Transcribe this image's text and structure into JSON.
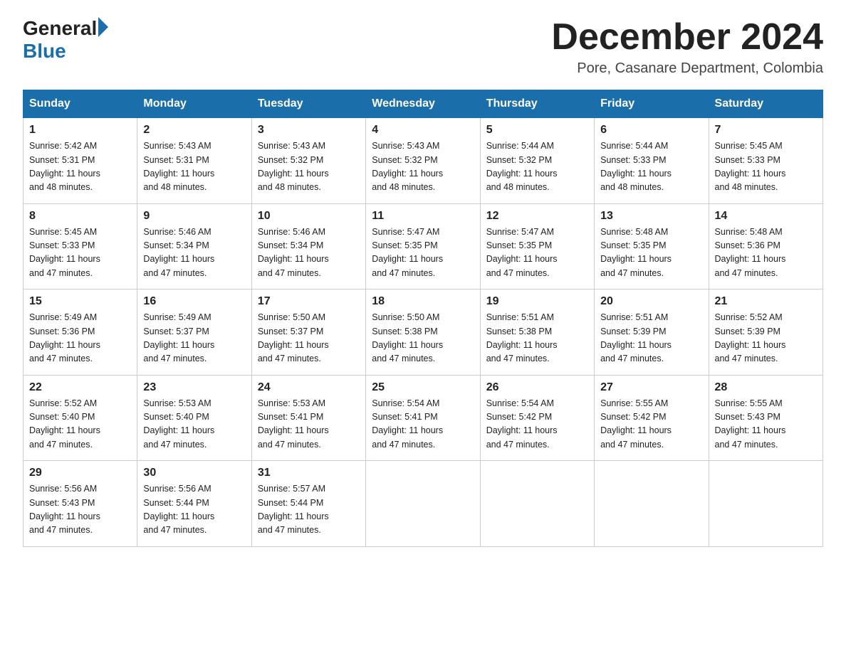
{
  "logo": {
    "general": "General",
    "arrow": "",
    "blue": "Blue"
  },
  "title": "December 2024",
  "location": "Pore, Casanare Department, Colombia",
  "days_of_week": [
    "Sunday",
    "Monday",
    "Tuesday",
    "Wednesday",
    "Thursday",
    "Friday",
    "Saturday"
  ],
  "weeks": [
    [
      {
        "day": "1",
        "sunrise": "5:42 AM",
        "sunset": "5:31 PM",
        "daylight": "11 hours and 48 minutes."
      },
      {
        "day": "2",
        "sunrise": "5:43 AM",
        "sunset": "5:31 PM",
        "daylight": "11 hours and 48 minutes."
      },
      {
        "day": "3",
        "sunrise": "5:43 AM",
        "sunset": "5:32 PM",
        "daylight": "11 hours and 48 minutes."
      },
      {
        "day": "4",
        "sunrise": "5:43 AM",
        "sunset": "5:32 PM",
        "daylight": "11 hours and 48 minutes."
      },
      {
        "day": "5",
        "sunrise": "5:44 AM",
        "sunset": "5:32 PM",
        "daylight": "11 hours and 48 minutes."
      },
      {
        "day": "6",
        "sunrise": "5:44 AM",
        "sunset": "5:33 PM",
        "daylight": "11 hours and 48 minutes."
      },
      {
        "day": "7",
        "sunrise": "5:45 AM",
        "sunset": "5:33 PM",
        "daylight": "11 hours and 48 minutes."
      }
    ],
    [
      {
        "day": "8",
        "sunrise": "5:45 AM",
        "sunset": "5:33 PM",
        "daylight": "11 hours and 47 minutes."
      },
      {
        "day": "9",
        "sunrise": "5:46 AM",
        "sunset": "5:34 PM",
        "daylight": "11 hours and 47 minutes."
      },
      {
        "day": "10",
        "sunrise": "5:46 AM",
        "sunset": "5:34 PM",
        "daylight": "11 hours and 47 minutes."
      },
      {
        "day": "11",
        "sunrise": "5:47 AM",
        "sunset": "5:35 PM",
        "daylight": "11 hours and 47 minutes."
      },
      {
        "day": "12",
        "sunrise": "5:47 AM",
        "sunset": "5:35 PM",
        "daylight": "11 hours and 47 minutes."
      },
      {
        "day": "13",
        "sunrise": "5:48 AM",
        "sunset": "5:35 PM",
        "daylight": "11 hours and 47 minutes."
      },
      {
        "day": "14",
        "sunrise": "5:48 AM",
        "sunset": "5:36 PM",
        "daylight": "11 hours and 47 minutes."
      }
    ],
    [
      {
        "day": "15",
        "sunrise": "5:49 AM",
        "sunset": "5:36 PM",
        "daylight": "11 hours and 47 minutes."
      },
      {
        "day": "16",
        "sunrise": "5:49 AM",
        "sunset": "5:37 PM",
        "daylight": "11 hours and 47 minutes."
      },
      {
        "day": "17",
        "sunrise": "5:50 AM",
        "sunset": "5:37 PM",
        "daylight": "11 hours and 47 minutes."
      },
      {
        "day": "18",
        "sunrise": "5:50 AM",
        "sunset": "5:38 PM",
        "daylight": "11 hours and 47 minutes."
      },
      {
        "day": "19",
        "sunrise": "5:51 AM",
        "sunset": "5:38 PM",
        "daylight": "11 hours and 47 minutes."
      },
      {
        "day": "20",
        "sunrise": "5:51 AM",
        "sunset": "5:39 PM",
        "daylight": "11 hours and 47 minutes."
      },
      {
        "day": "21",
        "sunrise": "5:52 AM",
        "sunset": "5:39 PM",
        "daylight": "11 hours and 47 minutes."
      }
    ],
    [
      {
        "day": "22",
        "sunrise": "5:52 AM",
        "sunset": "5:40 PM",
        "daylight": "11 hours and 47 minutes."
      },
      {
        "day": "23",
        "sunrise": "5:53 AM",
        "sunset": "5:40 PM",
        "daylight": "11 hours and 47 minutes."
      },
      {
        "day": "24",
        "sunrise": "5:53 AM",
        "sunset": "5:41 PM",
        "daylight": "11 hours and 47 minutes."
      },
      {
        "day": "25",
        "sunrise": "5:54 AM",
        "sunset": "5:41 PM",
        "daylight": "11 hours and 47 minutes."
      },
      {
        "day": "26",
        "sunrise": "5:54 AM",
        "sunset": "5:42 PM",
        "daylight": "11 hours and 47 minutes."
      },
      {
        "day": "27",
        "sunrise": "5:55 AM",
        "sunset": "5:42 PM",
        "daylight": "11 hours and 47 minutes."
      },
      {
        "day": "28",
        "sunrise": "5:55 AM",
        "sunset": "5:43 PM",
        "daylight": "11 hours and 47 minutes."
      }
    ],
    [
      {
        "day": "29",
        "sunrise": "5:56 AM",
        "sunset": "5:43 PM",
        "daylight": "11 hours and 47 minutes."
      },
      {
        "day": "30",
        "sunrise": "5:56 AM",
        "sunset": "5:44 PM",
        "daylight": "11 hours and 47 minutes."
      },
      {
        "day": "31",
        "sunrise": "5:57 AM",
        "sunset": "5:44 PM",
        "daylight": "11 hours and 47 minutes."
      },
      null,
      null,
      null,
      null
    ]
  ],
  "labels": {
    "sunrise": "Sunrise:",
    "sunset": "Sunset:",
    "daylight": "Daylight:"
  }
}
